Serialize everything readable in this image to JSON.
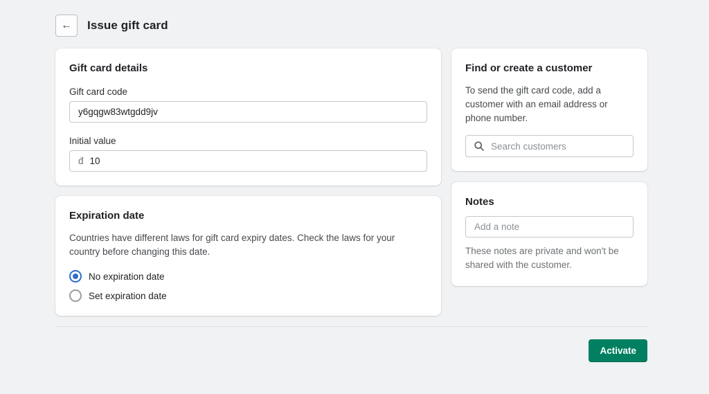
{
  "page": {
    "title": "Issue gift card"
  },
  "icons": {
    "back_arrow": "←"
  },
  "gift_card_details": {
    "heading": "Gift card details",
    "code_label": "Gift card code",
    "code_value": "y6gqgw83wtgdd9jv",
    "initial_value_label": "Initial value",
    "currency_prefix": "đ",
    "initial_value": "10"
  },
  "expiration": {
    "heading": "Expiration date",
    "description": "Countries have different laws for gift card expiry dates. Check the laws for your country before changing this date.",
    "options": [
      {
        "label": "No expiration date",
        "selected": true
      },
      {
        "label": "Set expiration date",
        "selected": false
      }
    ]
  },
  "customer": {
    "heading": "Find or create a customer",
    "description": "To send the gift card code, add a customer with an email address or phone number.",
    "search_placeholder": "Search customers"
  },
  "notes": {
    "heading": "Notes",
    "placeholder": "Add a note",
    "help_text": "These notes are private and won't be shared with the customer."
  },
  "footer": {
    "activate_label": "Activate"
  },
  "colors": {
    "primary_green": "#008060",
    "radio_blue": "#2c6ecb",
    "page_background": "#f1f2f4"
  }
}
